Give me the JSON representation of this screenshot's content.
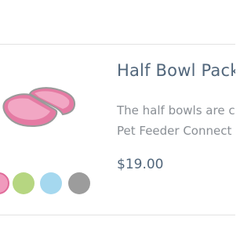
{
  "product": {
    "title": "Half Bowl Pack",
    "description_lines": [
      "The half bowls are co",
      "Pet Feeder Connect c"
    ],
    "price": "$19.00",
    "image_icon": "half-bowls-product-image",
    "swatches": [
      {
        "name": "pink",
        "color": "#f09abd",
        "selected": true
      },
      {
        "name": "green",
        "color": "#b6d681",
        "selected": false
      },
      {
        "name": "blue",
        "color": "#a5d8ef",
        "selected": false
      },
      {
        "name": "gray",
        "color": "#9c9c9c",
        "selected": false
      }
    ]
  }
}
